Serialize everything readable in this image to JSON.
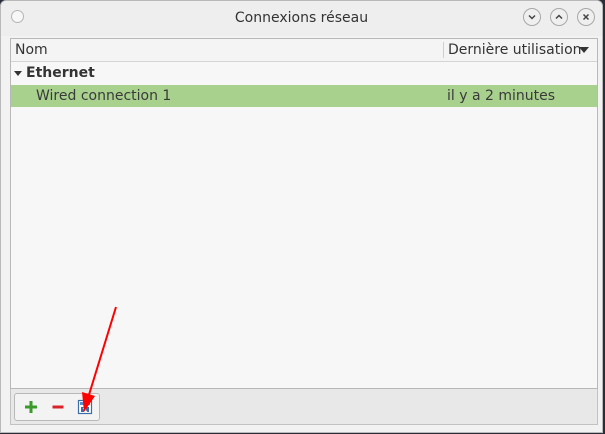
{
  "window": {
    "title": "Connexions réseau"
  },
  "columns": {
    "name_label": "Nom",
    "last_used_label": "Dernière utilisation"
  },
  "groups": [
    {
      "label": "Ethernet",
      "connections": [
        {
          "name": "Wired connection 1",
          "last_used": "il y a 2 minutes",
          "selected": true
        }
      ]
    }
  ],
  "toolbar": {
    "buttons": [
      {
        "icon": "add-icon"
      },
      {
        "icon": "remove-icon"
      },
      {
        "icon": "edit-settings-icon"
      }
    ]
  },
  "colors": {
    "selection": "#a9d18e",
    "add": "#3a9b2a",
    "remove": "#d8232a",
    "annotation_arrow": "#ff0000"
  }
}
